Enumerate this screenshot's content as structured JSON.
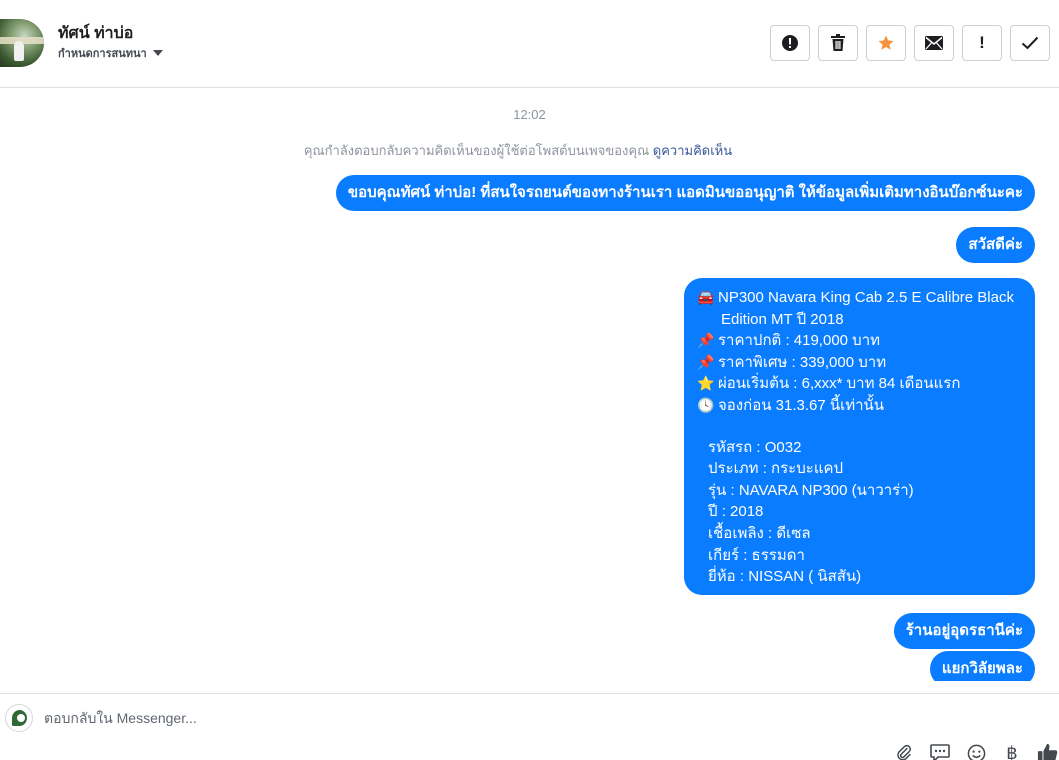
{
  "header": {
    "name": "ทัศน์ ท่าบ่อ",
    "assign_label": "กำหนดการสนทนา"
  },
  "actions": [
    {
      "name": "report-icon"
    },
    {
      "name": "trash-icon"
    },
    {
      "name": "star-icon",
      "color": "#f7923a"
    },
    {
      "name": "mail-icon"
    },
    {
      "name": "mark-important-icon",
      "label": "!"
    },
    {
      "name": "done-check-icon"
    }
  ],
  "chat": {
    "timestamp": "12:02",
    "notice_text": "คุณกำลังตอบกลับความคิดเห็นของผู้ใช้ต่อโพสต์บนเพจของคุณ",
    "notice_link": "ดูความคิดเห็น",
    "bubble_color": "#0a7cff",
    "messages": {
      "m1": "ขอบคุณทัศน์ ท่าบ่อ! ที่สนใจรถยนต์ของทางร้านเรา แอดมินขออนุญาติ ให้ข้อมูลเพิ่มเติมทางอินบ๊อกซ์นะคะ",
      "m2": "สวัสดีค่ะ",
      "m3": {
        "title_1": "NP300 Navara King Cab 2.5 E Calibre Black",
        "title_2": "Edition MT ปี 2018",
        "normal_price": "ราคาปกติ : 419,000 บาท",
        "special_price": "ราคาพิเศษ : 339,000 บาท",
        "installment": "ผ่อนเริ่มต้น : 6,xxx* บาท 84 เดือนแรก",
        "booking": "จองก่อน 31.3.67 นี้เท่านั้น",
        "code": "รหัสรถ : O032",
        "type": "ประเภท : กระบะแคป",
        "model": "รุ่น : NAVARA NP300 (นาวาร่า)",
        "year": "ปี : 2018",
        "fuel": "เชื้อเพลิง : ดีเซล",
        "gear": "เกียร์ : ธรรมดา",
        "brand": "ยี่ห้อ : NISSAN ( นิสสัน)"
      },
      "m4": "ร้านอยู่อุดรธานีค่ะ",
      "m5": "แยกวิลัยพละ"
    }
  },
  "composer": {
    "placeholder": "ตอบกลับใน Messenger...",
    "tools": [
      "paperclip-icon",
      "speech-bubble-icon",
      "emoji-icon",
      "baht-icon",
      "thumbs-up-icon"
    ],
    "baht_glyph": "฿"
  }
}
